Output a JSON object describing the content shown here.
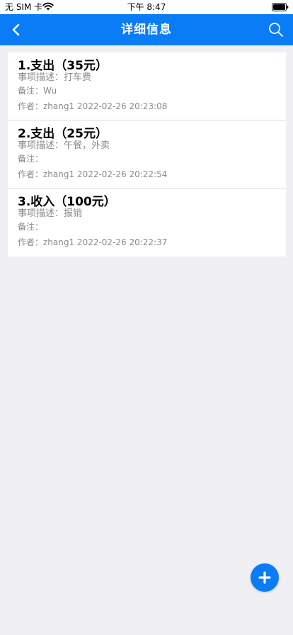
{
  "status_bar": {
    "carrier": "无 SIM 卡",
    "time": "下午 8:47"
  },
  "nav": {
    "title": "详细信息",
    "color": "#0a7cf6"
  },
  "records": [
    {
      "heading": "1.支出（35元）",
      "desc": "事项描述：打车费",
      "note": "备注：Wu",
      "meta": "作者：zhang1 2022-02-26 20:23:08"
    },
    {
      "heading": "2.支出（25元）",
      "desc": "事项描述：午餐，外卖",
      "note": "备注：",
      "meta": "作者：zhang1 2022-02-26 20:22:54"
    },
    {
      "heading": "3.收入（100元）",
      "desc": "事项描述：报销",
      "note": "备注：",
      "meta": "作者：zhang1 2022-02-26 20:22:37"
    }
  ],
  "icons": {
    "back": "chevron-left-icon",
    "search": "search-icon",
    "add": "plus-icon",
    "wifi": "wifi-icon",
    "battery": "battery-icon"
  }
}
